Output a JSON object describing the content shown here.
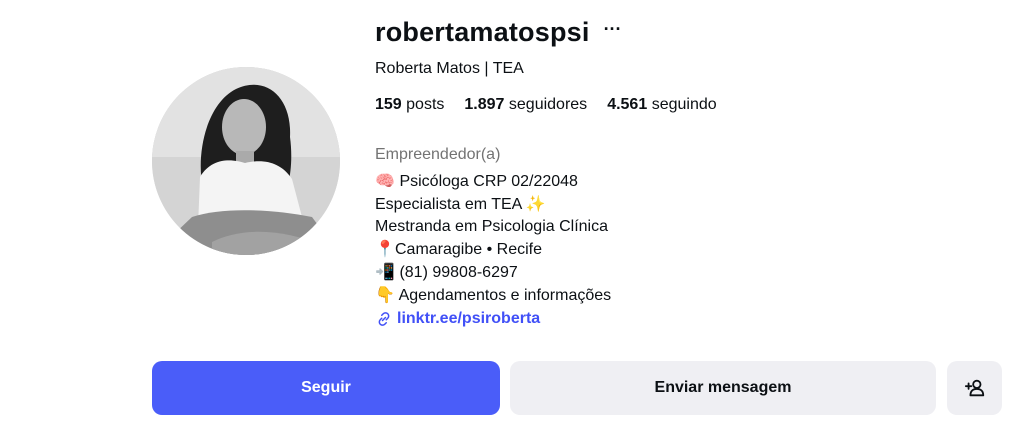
{
  "profile": {
    "username": "robertamatospsi",
    "more_label": "···",
    "full_name": "Roberta Matos | TEA",
    "stats": [
      {
        "count": "159",
        "label": "posts"
      },
      {
        "count": "1.897",
        "label": "seguidores"
      },
      {
        "count": "4.561",
        "label": "seguindo"
      }
    ],
    "category": "Empreendedor(a)",
    "bio": [
      {
        "emoji": "🧠",
        "text": " Psicóloga CRP 02/22048"
      },
      {
        "emoji": "",
        "text": "Especialista em TEA ✨"
      },
      {
        "emoji": "",
        "text": "Mestranda em Psicologia Clínica"
      },
      {
        "emoji": "📍",
        "text": "Camaragibe • Recife"
      },
      {
        "emoji": "📲",
        "text": " (81) 99808-6297"
      },
      {
        "emoji": "👇",
        "text": " Agendamentos e informações"
      }
    ],
    "link": "linktr.ee/psiroberta"
  },
  "actions": {
    "follow_label": "Seguir",
    "message_label": "Enviar mensagem",
    "add_icon": "add-person-icon"
  },
  "colors": {
    "accent": "#4a5df9",
    "link": "#4150f7",
    "secondary_button": "#efeff3",
    "muted_text": "#737373"
  }
}
